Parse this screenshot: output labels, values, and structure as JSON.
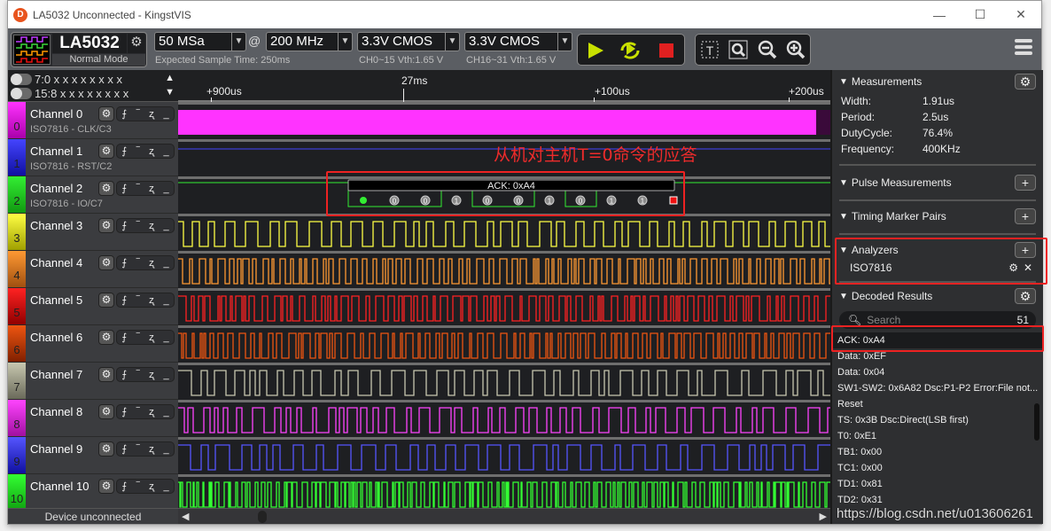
{
  "window": {
    "title": "LA5032 Unconnected - KingstVIS",
    "logo_letter": "D",
    "minimize": "—",
    "maximize": "☐",
    "close": "✕"
  },
  "toolbar": {
    "device_name": "LA5032",
    "device_mode": "Normal Mode",
    "sample_depth": "50 MSa",
    "at": "@",
    "sample_rate": "200 MHz",
    "expected_time": "Expected Sample Time: 250ms",
    "threshold_a": "3.3V CMOS",
    "threshold_a_sub": "CH0~15 Vth:1.65 V",
    "threshold_b": "3.3V CMOS",
    "threshold_b_sub": "CH16~31 Vth:1.65 V",
    "colors": {
      "play": "#c8e000",
      "stop": "#e02020"
    }
  },
  "pattern": {
    "row1": "7:0  x x x x x x x x",
    "row2": "15:8 x x x x x x x x",
    "up": "▲",
    "down": "▼"
  },
  "channels": [
    {
      "num": "0",
      "name": "Channel 0",
      "sub": "ISO7816 - CLK/C3",
      "color": "#ff33ff",
      "dark": "#aa00aa"
    },
    {
      "num": "1",
      "name": "Channel 1",
      "sub": "ISO7816 - RST/C2",
      "color": "#4444ff",
      "dark": "#1010a0"
    },
    {
      "num": "2",
      "name": "Channel 2",
      "sub": "ISO7816 - IO/C7",
      "color": "#33ee33",
      "dark": "#119911"
    },
    {
      "num": "3",
      "name": "Channel 3",
      "sub": "",
      "color": "#ffff44",
      "dark": "#a0a000"
    },
    {
      "num": "4",
      "name": "Channel 4",
      "sub": "",
      "color": "#ff9933",
      "dark": "#a05010"
    },
    {
      "num": "5",
      "name": "Channel 5",
      "sub": "",
      "color": "#ff2222",
      "dark": "#900000"
    },
    {
      "num": "6",
      "name": "Channel 6",
      "sub": "",
      "color": "#ee5511",
      "dark": "#802000"
    },
    {
      "num": "7",
      "name": "Channel 7",
      "sub": "",
      "color": "#c8c8b0",
      "dark": "#6a6a5a"
    },
    {
      "num": "8",
      "name": "Channel 8",
      "sub": "",
      "color": "#ff44ff",
      "dark": "#a010a0"
    },
    {
      "num": "9",
      "name": "Channel 9",
      "sub": "",
      "color": "#5555ff",
      "dark": "#1010a0"
    },
    {
      "num": "10",
      "name": "Channel 10",
      "sub": "",
      "color": "#33ff33",
      "dark": "#10a010"
    }
  ],
  "status": {
    "text": "Device unconnected"
  },
  "ruler": {
    "ticks": [
      {
        "label": "+900us",
        "pos": "left"
      },
      {
        "label": "27ms",
        "pos": "center"
      },
      {
        "label": "+100us",
        "pos": "right"
      },
      {
        "label": "+200us",
        "pos": "far-right"
      }
    ]
  },
  "decode": {
    "label": "ACK: 0xA4",
    "bits": [
      "start",
      "0",
      "0",
      "1",
      "0",
      "0",
      "1",
      "0",
      "1",
      "1",
      "stop"
    ]
  },
  "annotation": "从机对主机T=0命令的应答",
  "sidebar": {
    "measurements": {
      "title": "Measurements",
      "rows": [
        {
          "k": "Width:",
          "v": "1.91us"
        },
        {
          "k": "Period:",
          "v": "2.5us"
        },
        {
          "k": "DutyCycle:",
          "v": "76.4%"
        },
        {
          "k": "Frequency:",
          "v": "400KHz"
        }
      ]
    },
    "pulse": {
      "title": "Pulse Measurements"
    },
    "timing": {
      "title": "Timing Marker Pairs"
    },
    "analyzers": {
      "title": "Analyzers",
      "items": [
        {
          "name": "ISO7816"
        }
      ]
    },
    "decoded": {
      "title": "Decoded Results",
      "search_placeholder": "Search",
      "count": "51",
      "results": [
        "ACK: 0xA4",
        "Data: 0xEF",
        "Data: 0x04",
        "SW1-SW2: 0x6A82 Dsc:P1-P2 Error:File not...",
        "Reset",
        "TS: 0x3B Dsc:Direct(LSB first)",
        "T0: 0xE1",
        "TB1: 0x00",
        "TC1: 0x00",
        "TD1: 0x81",
        "TD2: 0x31"
      ]
    }
  },
  "watermark": "https://blog.csdn.net/u013606261"
}
